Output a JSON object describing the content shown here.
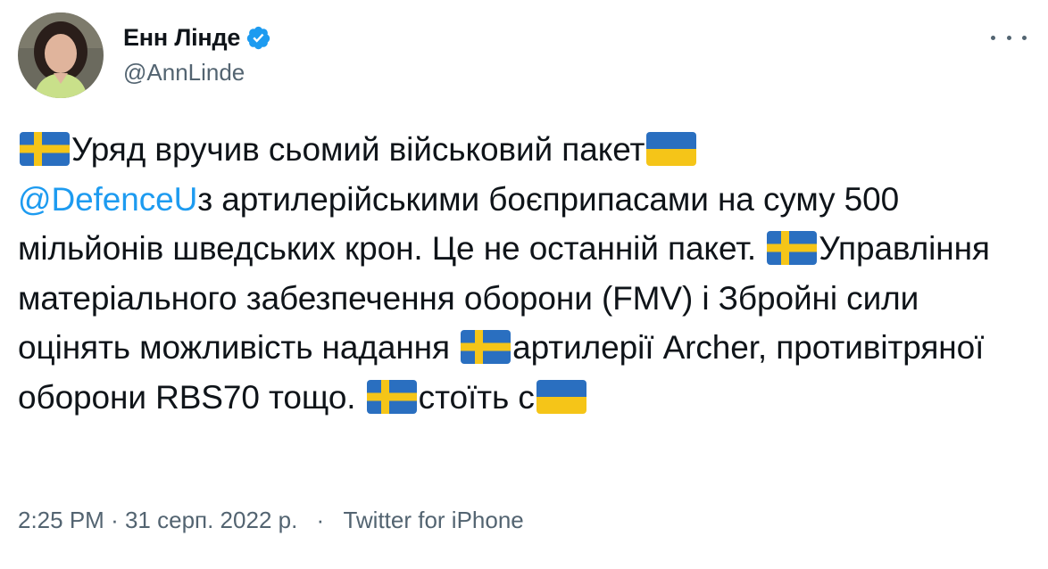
{
  "author": {
    "display_name": "Енн Лінде",
    "handle": "@AnnLinde",
    "verified": true,
    "verified_icon": "verified-badge-icon",
    "accent_color": "#1d9bf0"
  },
  "more_menu": {
    "icon": "more-horizontal-icon"
  },
  "tweet": {
    "line1_text": "Уряд вручив сьомий військовий пакет",
    "mention": "@DefenceU",
    "line2_text": "з артилерійськими боєприпасами на суму 500 мільйонів шведських крон. Це не останній пакет. ",
    "line3_text": "Управління матеріального забезпечення оборони (FMV) і Збройні сили оцінять можливість надання ",
    "line4_text": "артилерії Archer, противітряної оборони RBS70 тощо. ",
    "line5_text": "стоїть с",
    "flags": {
      "sweden": "sweden-flag-icon",
      "ukraine": "ukraine-flag-icon"
    }
  },
  "meta": {
    "time": "2:25 PM",
    "date": "31 серп. 2022 р.",
    "separator": "·",
    "source": "Twitter for iPhone"
  }
}
